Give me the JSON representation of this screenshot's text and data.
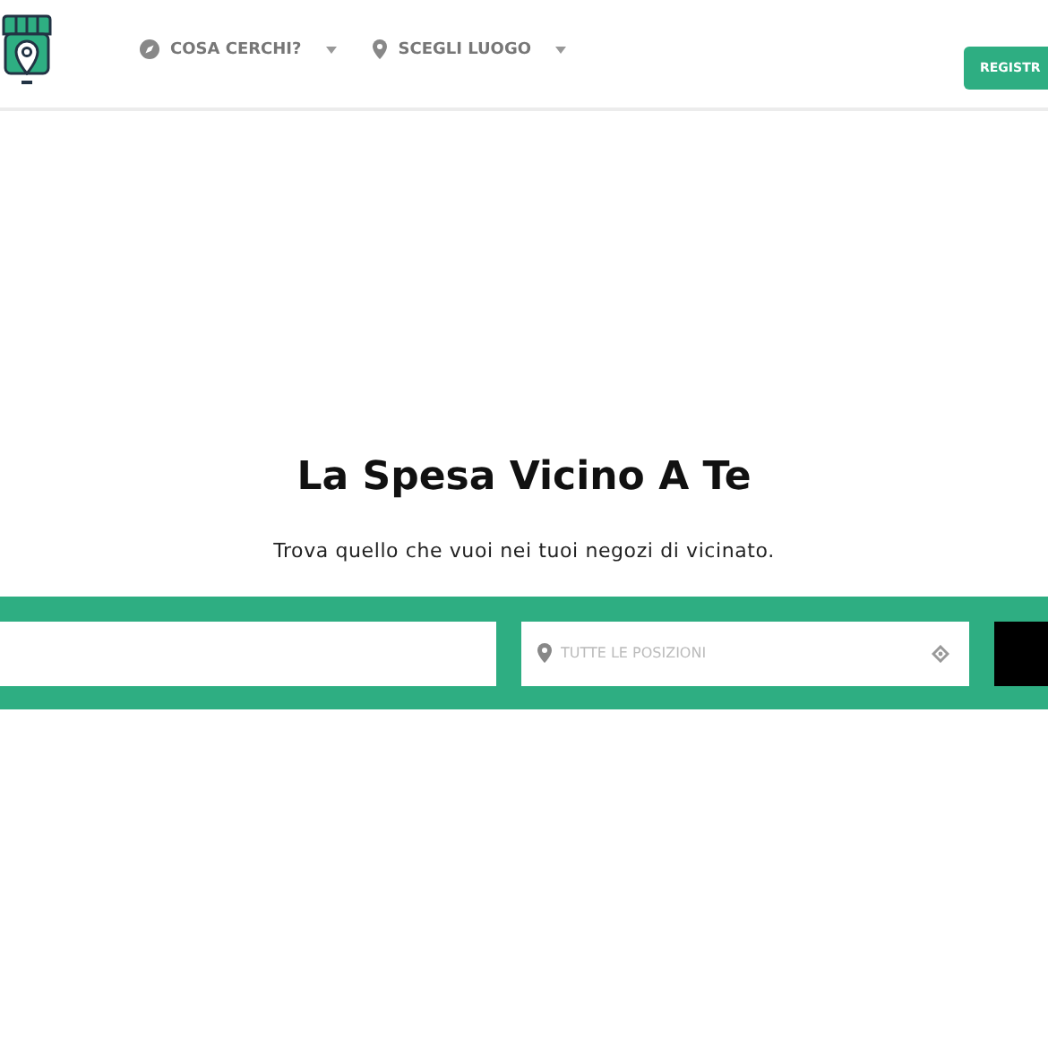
{
  "header": {
    "nav": [
      {
        "label": "COSA CERCHI?",
        "kind": "category"
      },
      {
        "label": "SCEGLI LUOGO",
        "kind": "location"
      }
    ],
    "register_button": "REGISTR"
  },
  "hero": {
    "title": "La Spesa Vicino A Te",
    "subtitle": "Trova quello che vuoi nei tuoi negozi di vicinato.",
    "location_field": {
      "placeholder": "TUTTE LE POSIZIONI"
    }
  }
}
